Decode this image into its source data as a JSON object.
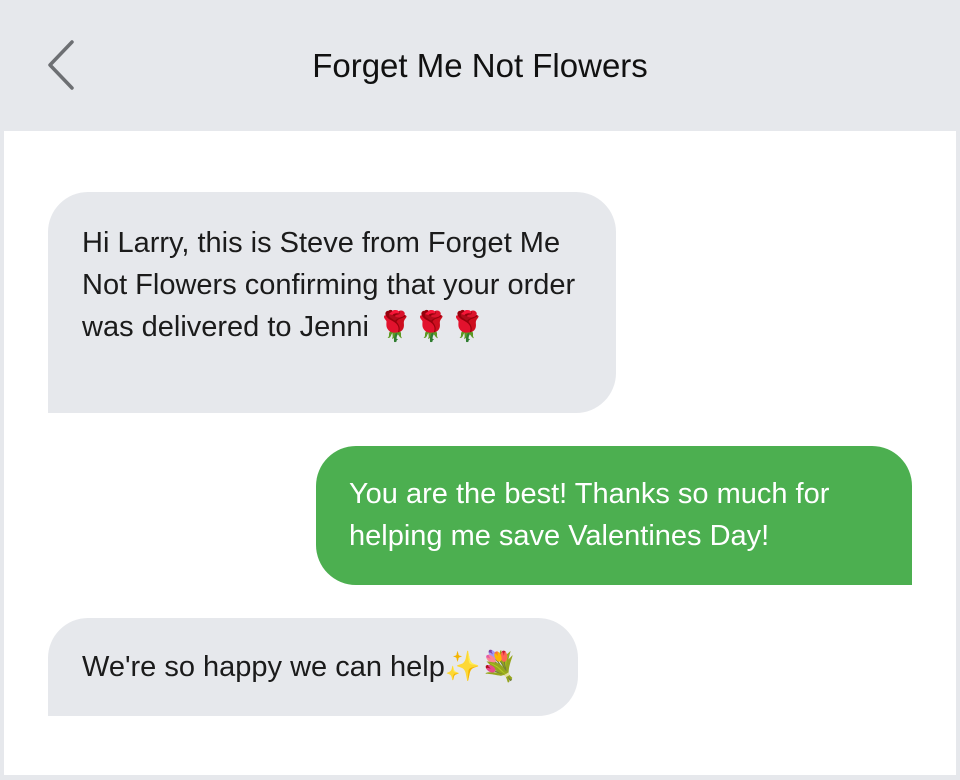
{
  "header": {
    "title": "Forget Me Not Flowers",
    "back_icon": "chevron-left-icon"
  },
  "messages": [
    {
      "direction": "incoming",
      "text": "Hi Larry, this is Steve from Forget Me Not Flowers confirming that your order was delivered to Jenni 🌹🌹🌹"
    },
    {
      "direction": "outgoing",
      "text": "You are the best! Thanks so much for helping me save Valentines Day!"
    },
    {
      "direction": "incoming",
      "text": "We're so happy we can help✨💐"
    }
  ],
  "colors": {
    "header_bg": "#e6e8ec",
    "incoming_bubble": "#e6e8ec",
    "outgoing_bubble": "#4caf50",
    "thread_bg": "#ffffff"
  }
}
